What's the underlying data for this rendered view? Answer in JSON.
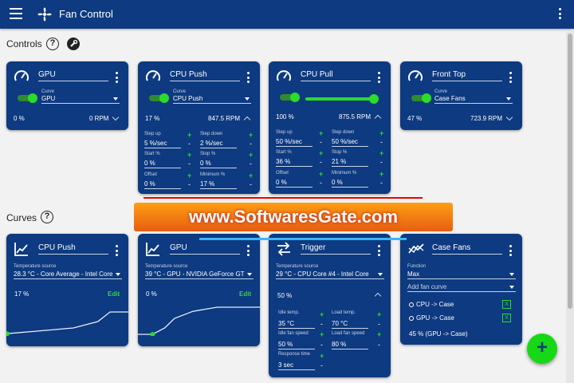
{
  "app": {
    "title": "Fan Control"
  },
  "sections": {
    "controls": "Controls",
    "curves": "Curves",
    "help": "?"
  },
  "controls": [
    {
      "name": "GPU",
      "curve_label": "Curve",
      "curve": "GPU",
      "percent": "0 %",
      "rpm": "0 RPM"
    },
    {
      "name": "CPU Push",
      "curve_label": "Curve",
      "curve": "CPU Push",
      "percent": "17 %",
      "rpm": "847.5 RPM",
      "fields": [
        {
          "label": "Step up",
          "value": "5 %/sec"
        },
        {
          "label": "Step down",
          "value": "2 %/sec"
        },
        {
          "label": "Start %",
          "value": "0 %"
        },
        {
          "label": "Stop %",
          "value": "0 %"
        },
        {
          "label": "Offset",
          "value": "0 %"
        },
        {
          "label": "Minimum %",
          "value": "17 %"
        }
      ]
    },
    {
      "name": "CPU Pull",
      "percent": "100 %",
      "rpm": "875.5 RPM",
      "fields": [
        {
          "label": "Step up",
          "value": "50 %/sec"
        },
        {
          "label": "Step down",
          "value": "50 %/sec"
        },
        {
          "label": "Start %",
          "value": "36 %"
        },
        {
          "label": "Stop %",
          "value": "21 %"
        },
        {
          "label": "Offset",
          "value": "0 %"
        },
        {
          "label": "Minimum %",
          "value": "0 %"
        }
      ]
    },
    {
      "name": "Front Top",
      "curve_label": "Curve",
      "curve": "Case Fans",
      "percent": "47 %",
      "rpm": "723.9 RPM"
    }
  ],
  "curves": [
    {
      "name": "CPU Push",
      "source_label": "Temperature source",
      "source": "28.3 °C - Core Average - Intel Core",
      "percent": "17 %",
      "edit": "Edit",
      "points": [
        [
          0,
          0.02
        ],
        [
          0.25,
          0.1
        ],
        [
          0.55,
          0.2
        ],
        [
          0.75,
          0.4
        ],
        [
          0.85,
          0.7
        ],
        [
          1,
          0.7
        ]
      ]
    },
    {
      "name": "GPU",
      "source_label": "Temperature source",
      "source": "39 °C - GPU - NVIDIA GeForce GT",
      "percent": "0 %",
      "edit": "Edit",
      "points": [
        [
          0,
          0
        ],
        [
          0.12,
          0
        ],
        [
          0.22,
          0.2
        ],
        [
          0.3,
          0.5
        ],
        [
          0.45,
          0.72
        ],
        [
          0.65,
          0.85
        ],
        [
          1,
          0.85
        ]
      ]
    },
    {
      "name": "Trigger",
      "source_label": "Temperature source",
      "source": "29 °C - CPU Core #4 - Intel Core",
      "percent": "50 %",
      "fields": [
        {
          "label": "Idle temp.",
          "value": "35 °C"
        },
        {
          "label": "Load temp.",
          "value": "70 °C"
        },
        {
          "label": "Idle fan speed",
          "value": "50 %"
        },
        {
          "label": "Load fan speed",
          "value": "80 %"
        },
        {
          "label": "Response time",
          "value": "3 sec"
        }
      ]
    },
    {
      "name": "Case Fans",
      "function_label": "Function",
      "function": "Max",
      "add_label": "Add fan curve",
      "items": [
        {
          "label": "CPU -> Case",
          "remove": "X"
        },
        {
          "label": "GPU -> Case",
          "remove": "X"
        }
      ],
      "result": "45 % (GPU -> Case)"
    }
  ],
  "fab": {
    "label": "+"
  },
  "watermark": {
    "text": "www.SoftwaresGate.com"
  },
  "colors": {
    "card": "#0d3a80",
    "accent": "#2bdc2b",
    "background": "#f2f2f2"
  }
}
